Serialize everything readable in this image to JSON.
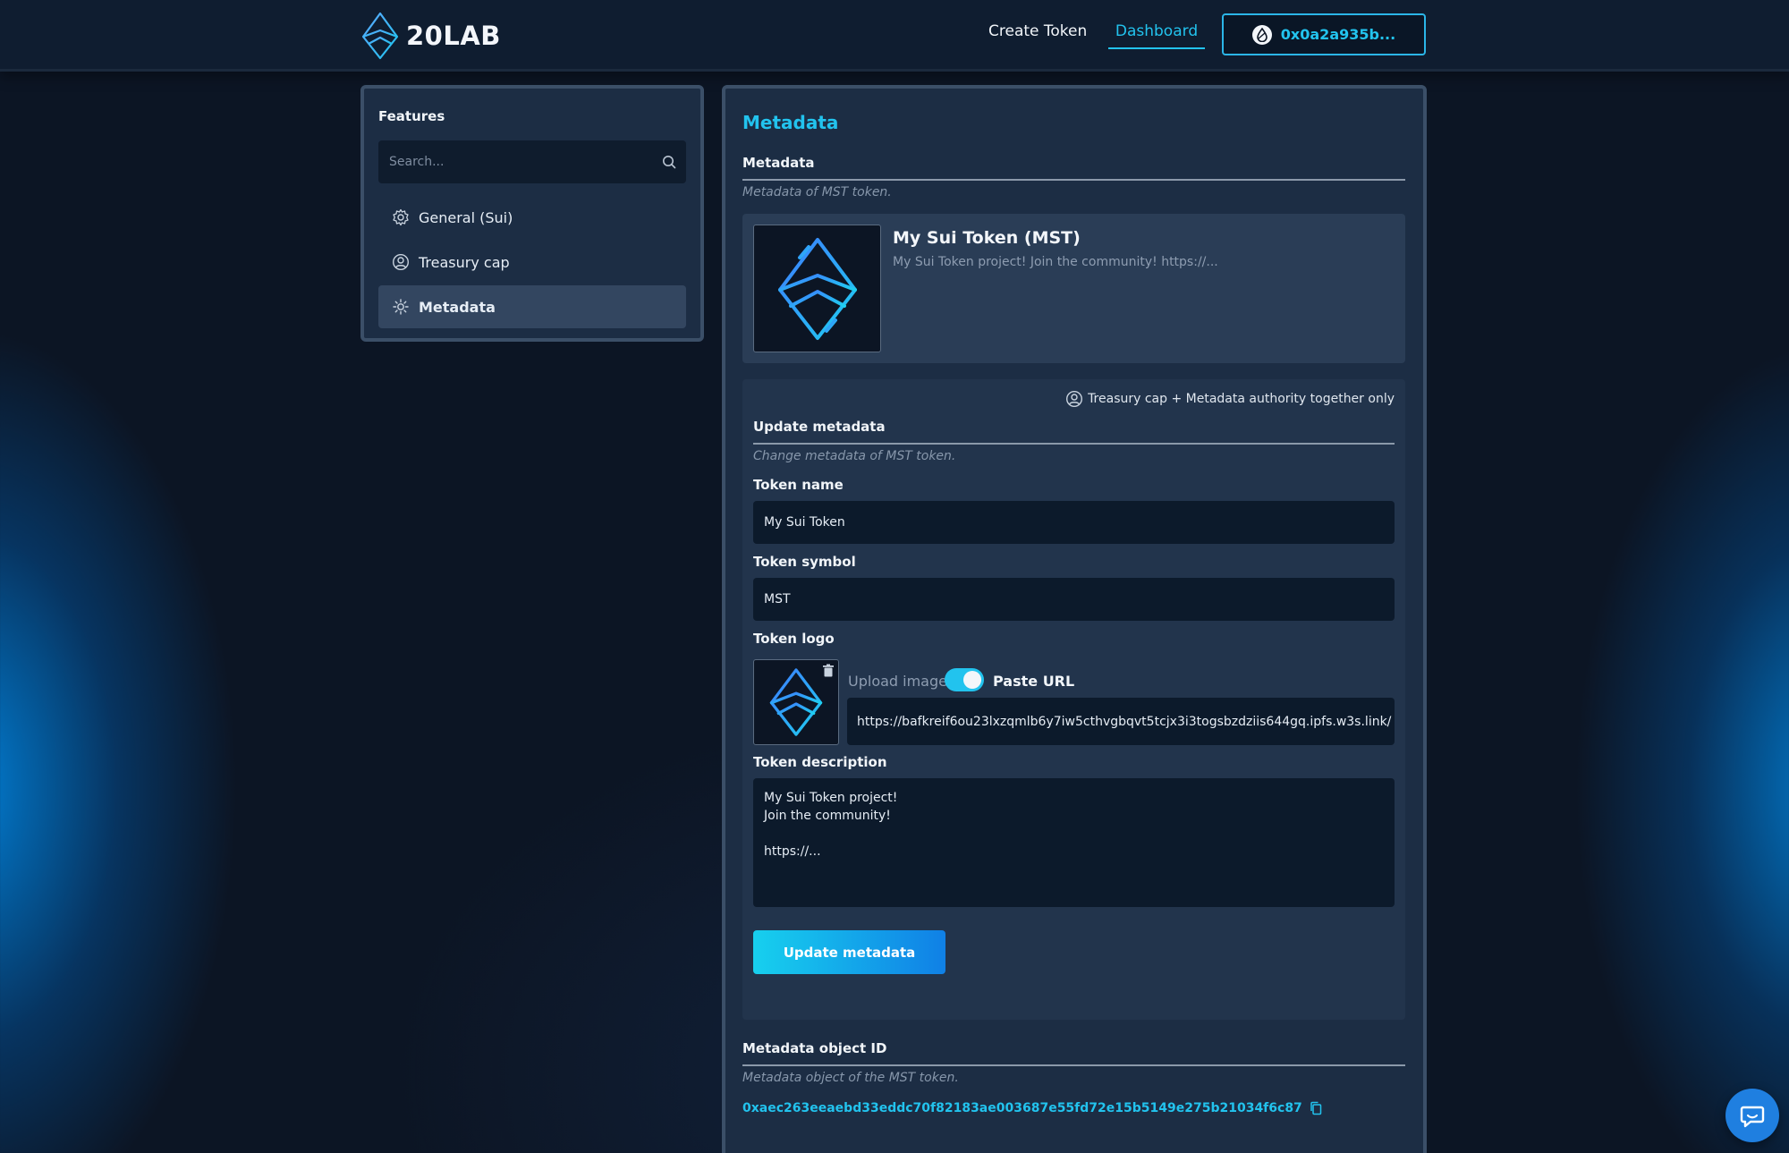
{
  "header": {
    "brand": "20LAB",
    "nav": {
      "create_token": "Create Token",
      "dashboard": "Dashboard"
    },
    "wallet_address": "0x0a2a935b..."
  },
  "sidebar": {
    "title": "Features",
    "search_placeholder": "Search...",
    "items": [
      {
        "label": "General (Sui)",
        "icon": "settings-icon",
        "active": false
      },
      {
        "label": "Treasury cap",
        "icon": "user-circle-icon",
        "active": false
      },
      {
        "label": "Metadata",
        "icon": "metadata-settings-icon",
        "active": true
      }
    ]
  },
  "main": {
    "title": "Metadata",
    "metadata_section": {
      "heading": "Metadata",
      "description": "Metadata of MST token.",
      "token_display_name": "My Sui Token (MST)",
      "token_display_description": "My Sui Token project! Join the community! https://..."
    },
    "update_section": {
      "authority_note": "Treasury cap + Metadata authority together only",
      "heading": "Update metadata",
      "description": "Change metadata of MST token.",
      "token_name_label": "Token name",
      "token_name_value": "My Sui Token",
      "token_symbol_label": "Token symbol",
      "token_symbol_value": "MST",
      "token_logo_label": "Token logo",
      "upload_image_label": "Upload image",
      "paste_url_label": "Paste URL",
      "paste_url_toggle_on": true,
      "logo_url_value": "https://bafkreif6ou23lxzqmlb6y7iw5cthvgbqvt5tcjx3i3togsbzdziis644gq.ipfs.w3s.link/",
      "token_description_label": "Token description",
      "token_description_value": "My Sui Token project!\nJoin the community!\n\nhttps://...",
      "submit_label": "Update metadata"
    },
    "object_id_section": {
      "heading": "Metadata object ID",
      "description": "Metadata object of the MST token.",
      "object_id": "0xaec263eeaebd33eddc70f82183ae003687e55fd72e15b5149e275b21034f6c87"
    }
  },
  "colors": {
    "accent": "#22c3ee",
    "background": "#0c1524",
    "card": "#1c2d44",
    "input": "#0c1a2b"
  }
}
